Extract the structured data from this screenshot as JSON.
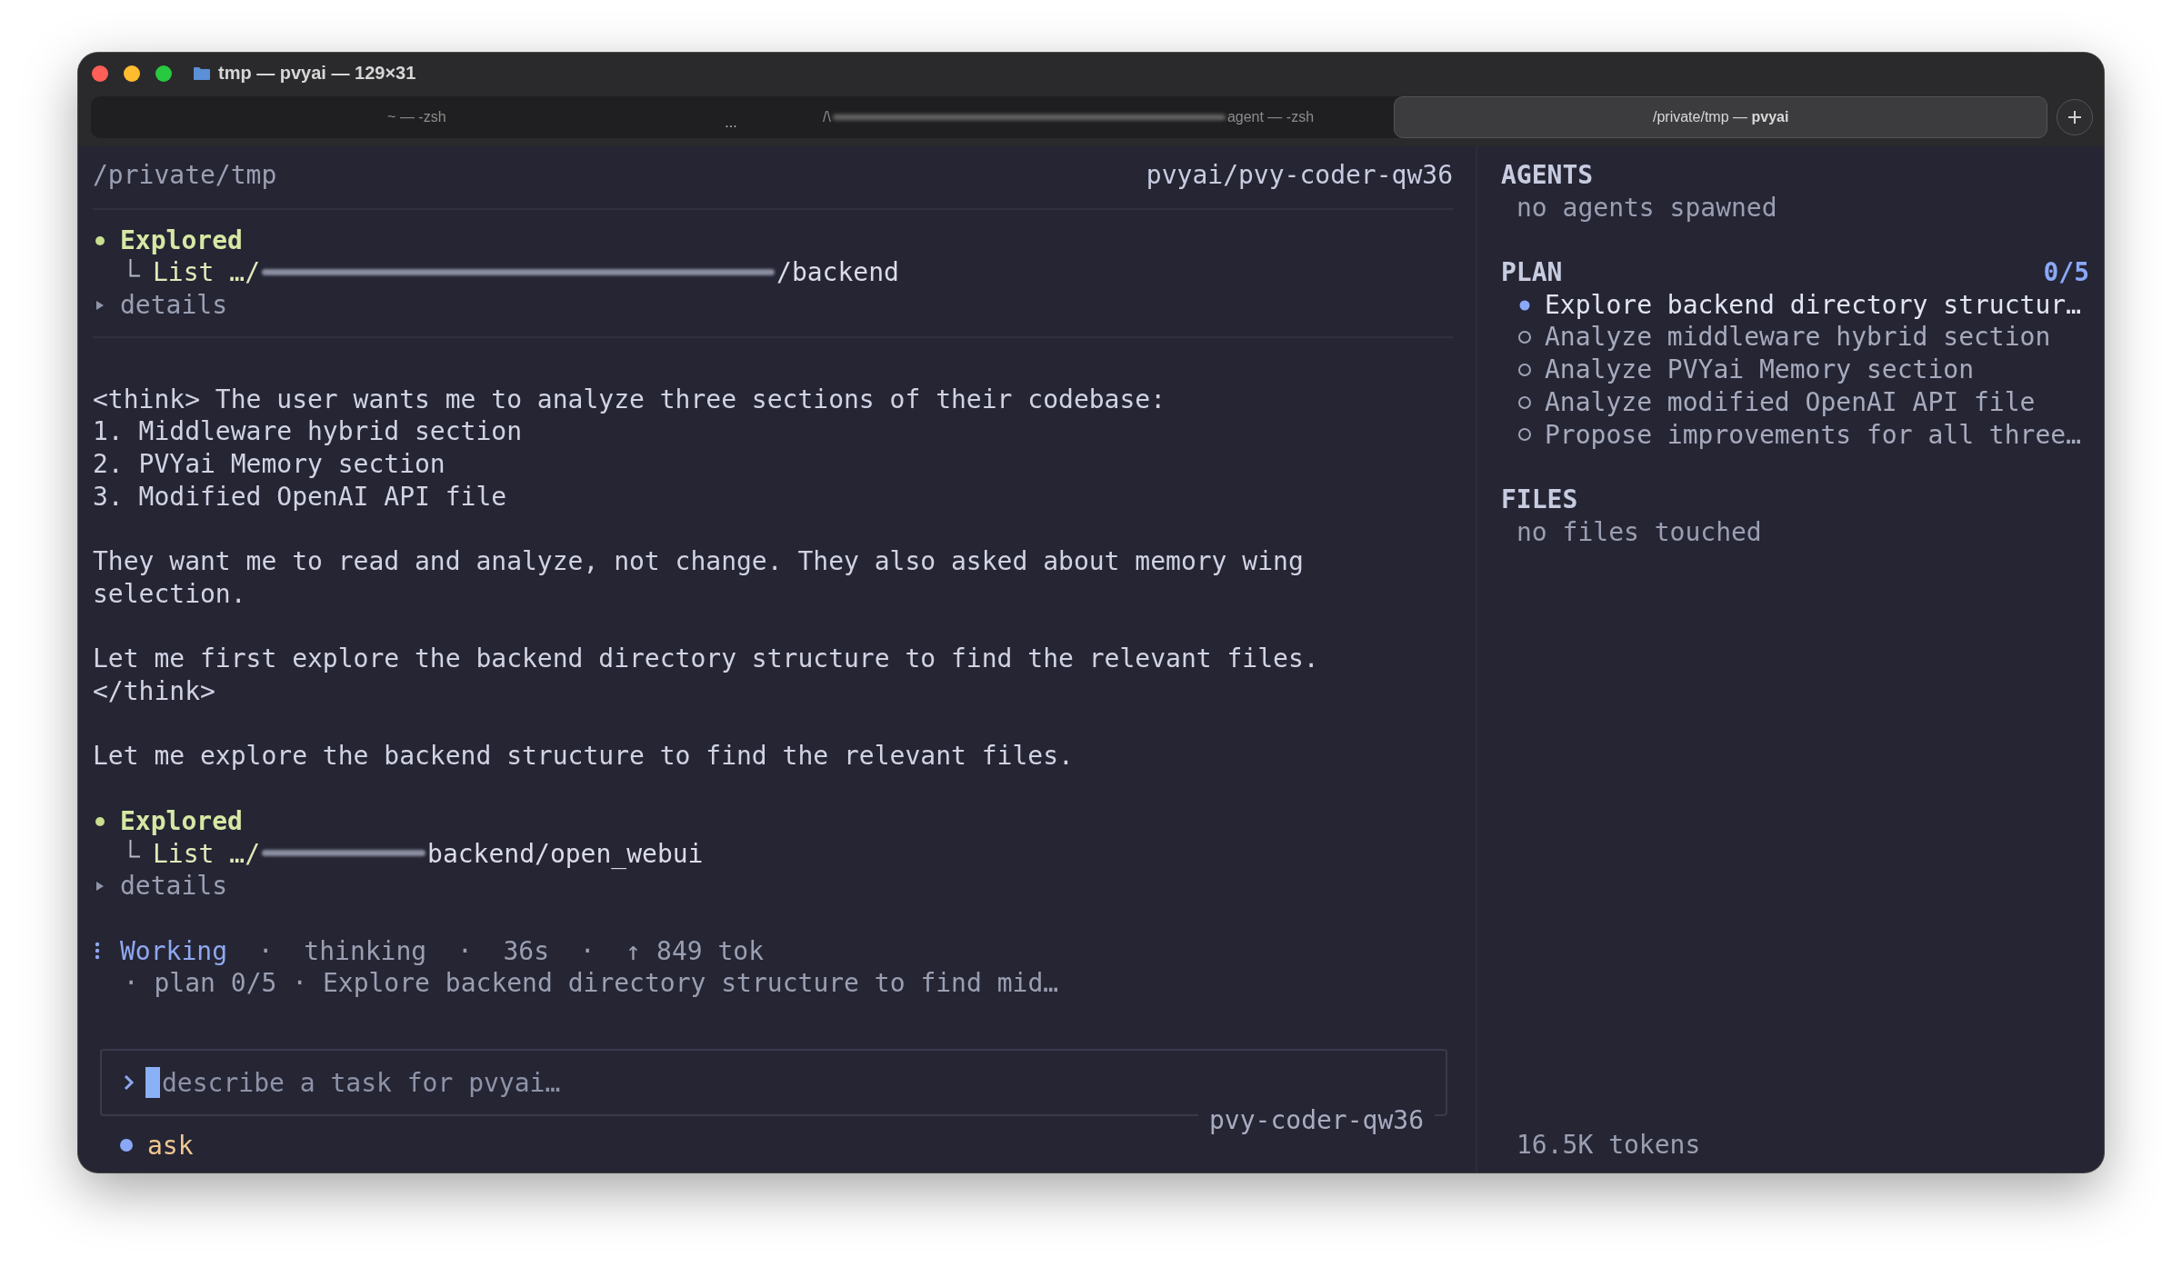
{
  "window": {
    "title": "tmp — pvyai — 129×31"
  },
  "tabs": [
    {
      "label": "~ — -zsh",
      "trailing": "...",
      "selected": false
    },
    {
      "label": "/\\",
      "label_after_redaction": "agent — -zsh",
      "selected": false
    },
    {
      "label": "/private/tmp — **pvyai**",
      "selected": true
    }
  ],
  "header": {
    "path": "/private/tmp",
    "model": "pvyai/pvy-coder-qw36"
  },
  "transcript": [
    {
      "kind": "tool",
      "title": "Explored",
      "verb": "List",
      "prefix": "…/",
      "suffix": "/backend",
      "details": "details",
      "expanded": false
    },
    {
      "kind": "message",
      "paragraphs": [
        "<think> The user wants me to analyze three sections of their codebase:\n1. Middleware hybrid section\n2. PVYai Memory section\n3. Modified OpenAI API file",
        "They want me to read and analyze, not change. They also asked about memory wing\nselection.",
        "Let me first explore the backend directory structure to find the relevant files.\n</think>",
        "Let me explore the backend structure to find the relevant files."
      ]
    },
    {
      "kind": "tool",
      "title": "Explored",
      "verb": "List",
      "prefix": "…/",
      "suffix": "backend/open_webui",
      "details": "details",
      "expanded": false
    },
    {
      "kind": "status",
      "label": "Working",
      "meta": "·  thinking  ·  36s  ·  ↑ 849 tok",
      "detail": "· plan 0/5 · Explore backend directory structure to find mid…"
    }
  ],
  "input": {
    "placeholder": "describe a task for pvyai…",
    "model": "pvy-coder-qw36"
  },
  "mode": {
    "label": "ask"
  },
  "sidebar": {
    "agents": {
      "title": "AGENTS",
      "empty": "no agents spawned"
    },
    "plan": {
      "title": "PLAN",
      "progress": "0/5",
      "in_progress": true,
      "items": [
        {
          "text": "Explore backend directory structur…",
          "active": true
        },
        {
          "text": "Analyze middleware hybrid section",
          "active": false
        },
        {
          "text": "Analyze PVYai Memory section",
          "active": false
        },
        {
          "text": "Analyze modified OpenAI API file",
          "active": false
        },
        {
          "text": "Propose improvements for all three…",
          "active": false
        }
      ]
    },
    "files": {
      "title": "FILES",
      "empty": "no files touched"
    },
    "tokens": "16.5K tokens"
  }
}
